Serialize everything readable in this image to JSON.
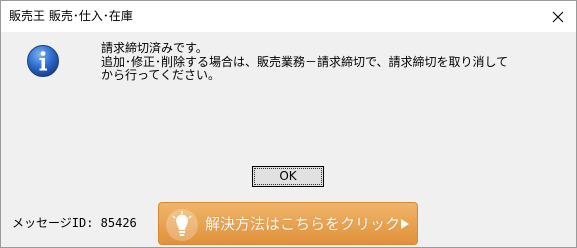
{
  "window": {
    "title": "販売王 販売･仕入･在庫",
    "close_icon": "close-icon"
  },
  "dialog": {
    "icon": "info-icon",
    "message_lines": [
      "請求締切済みです。",
      "追加･修正･削除する場合は、販売業務－請求締切で、請求締切を取り消して",
      "から行ってください。"
    ],
    "ok_label": "OK",
    "message_id": "メッセージID: 85426",
    "help_button": {
      "label": "解決方法はこちらをクリック",
      "icon": "lightbulb-icon",
      "arrow_icon": "arrow-right-icon",
      "color": "#e8a04e"
    }
  }
}
